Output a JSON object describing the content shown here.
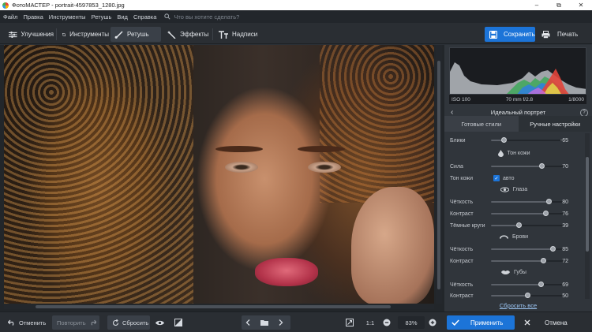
{
  "window": {
    "title": "ФотоМАСТЕР - portrait-4597853_1280.jpg",
    "minimize": "–",
    "maximize": "⧉",
    "close": "✕"
  },
  "menu": {
    "items": [
      "Файл",
      "Правка",
      "Инструменты",
      "Ретушь",
      "Вид",
      "Справка"
    ],
    "search_placeholder": "Что вы хотите сделать?"
  },
  "toolbar": {
    "tabs": [
      "Улучшения",
      "Инструменты",
      "Ретушь",
      "Эффекты",
      "Надписи"
    ],
    "active_tab": "Ретушь",
    "save_label": "Сохранить",
    "print_label": "Печать"
  },
  "histogram": {
    "iso": "ISO 100",
    "lens": "70 mm f/2.8",
    "shutter": "1/8000"
  },
  "panel": {
    "title": "Идеальный портрет",
    "help": "?",
    "tabs": [
      "Готовые стили",
      "Ручные настройки"
    ],
    "active_tab": "Ручные настройки",
    "reset_all": "Сбросить все",
    "sliders": {
      "highlights": {
        "label": "Блики",
        "value": "-65",
        "level": 0.175
      },
      "skin_strength": {
        "label": "Сила",
        "value": "70",
        "level": 0.7
      },
      "eye_clarity": {
        "label": "Чёткость",
        "value": "80",
        "level": 0.8
      },
      "eye_contrast": {
        "label": "Контраст",
        "value": "76",
        "level": 0.76
      },
      "dark_circles": {
        "label": "Тёмные круги",
        "value": "39",
        "level": 0.39
      },
      "brow_clarity": {
        "label": "Чёткость",
        "value": "85",
        "level": 0.85
      },
      "brow_contrast": {
        "label": "Контраст",
        "value": "72",
        "level": 0.72
      },
      "lip_clarity": {
        "label": "Чёткость",
        "value": "69",
        "level": 0.69
      },
      "lip_contrast": {
        "label": "Контраст",
        "value": "50",
        "level": 0.5
      }
    },
    "sections": {
      "skin": "Тон кожи",
      "eyes": "Глаза",
      "brows": "Брови",
      "lips": "Губы"
    },
    "skin_tone": {
      "label": "Тон кожи",
      "checkbox_label": "авто",
      "checked": true
    }
  },
  "bottom": {
    "undo": "Отменить",
    "redo": "Повторить",
    "reset": "Сбросить",
    "zoom_ratio": "1:1",
    "zoom_percent": "83%",
    "apply": "Применить",
    "cancel": "Отмена"
  },
  "colors": {
    "accent": "#1c74d8",
    "panel_bg": "#30353b",
    "app_bg": "#2b3036"
  }
}
